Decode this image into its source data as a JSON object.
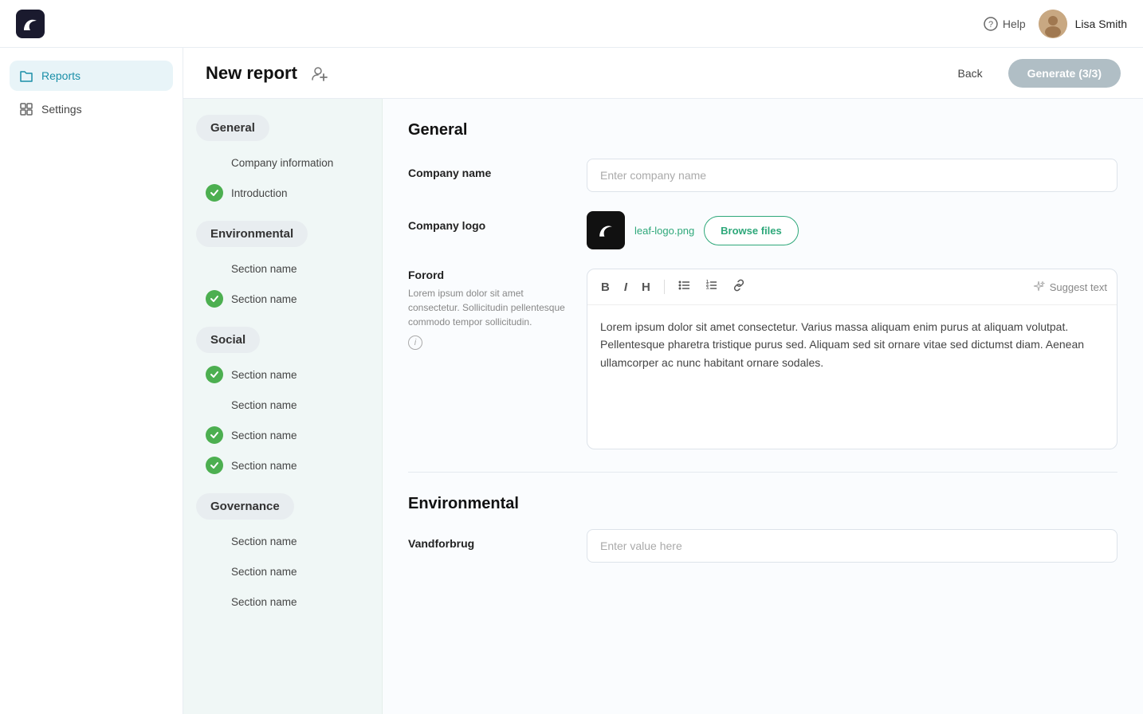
{
  "topbar": {
    "help_label": "Help",
    "username": "Lisa Smith"
  },
  "sidebar": {
    "items": [
      {
        "id": "reports",
        "label": "Reports",
        "icon": "folder-icon",
        "active": true
      },
      {
        "id": "settings",
        "label": "Settings",
        "icon": "grid-icon",
        "active": false
      }
    ]
  },
  "page": {
    "title": "New report",
    "back_label": "Back",
    "generate_label": "Generate (3/3)"
  },
  "left_nav": {
    "sections": [
      {
        "id": "general",
        "label": "General",
        "items": [
          {
            "label": "Company information",
            "checked": false
          },
          {
            "label": "Introduction",
            "checked": true
          }
        ]
      },
      {
        "id": "environmental",
        "label": "Environmental",
        "items": [
          {
            "label": "Section name",
            "checked": false
          },
          {
            "label": "Section name",
            "checked": true
          }
        ]
      },
      {
        "id": "social",
        "label": "Social",
        "items": [
          {
            "label": "Section name",
            "checked": true
          },
          {
            "label": "Section name",
            "checked": false
          },
          {
            "label": "Section name",
            "checked": true
          },
          {
            "label": "Section name",
            "checked": true
          }
        ]
      },
      {
        "id": "governance",
        "label": "Governance",
        "items": [
          {
            "label": "Section name",
            "checked": false
          },
          {
            "label": "Section name",
            "checked": false
          },
          {
            "label": "Section name",
            "checked": false
          }
        ]
      }
    ]
  },
  "form": {
    "general_title": "General",
    "company_name_label": "Company name",
    "company_name_placeholder": "Enter company name",
    "company_logo_label": "Company logo",
    "logo_filename": "leaf-logo.png",
    "browse_label": "Browse files",
    "forord_label": "Forord",
    "forord_desc": "Lorem ipsum dolor sit amet consectetur. Sollicitudin pellentesque commodo tempor sollicitudin.",
    "forord_content": "Lorem ipsum dolor sit amet consectetur. Varius massa aliquam enim purus at aliquam volutpat. Pellentesque pharetra tristique purus sed. Aliquam sed sit ornare vitae sed dictumst diam. Aenean ullamcorper ac nunc habitant ornare sodales.",
    "suggest_label": "Suggest text",
    "toolbar": {
      "bold": "B",
      "italic": "I",
      "heading": "H",
      "ul": "≡",
      "ol": "≡",
      "link": "🔗"
    },
    "env_title": "Environmental",
    "vandforbrug_label": "Vandforbrug",
    "vandforbrug_placeholder": "Enter value here"
  }
}
